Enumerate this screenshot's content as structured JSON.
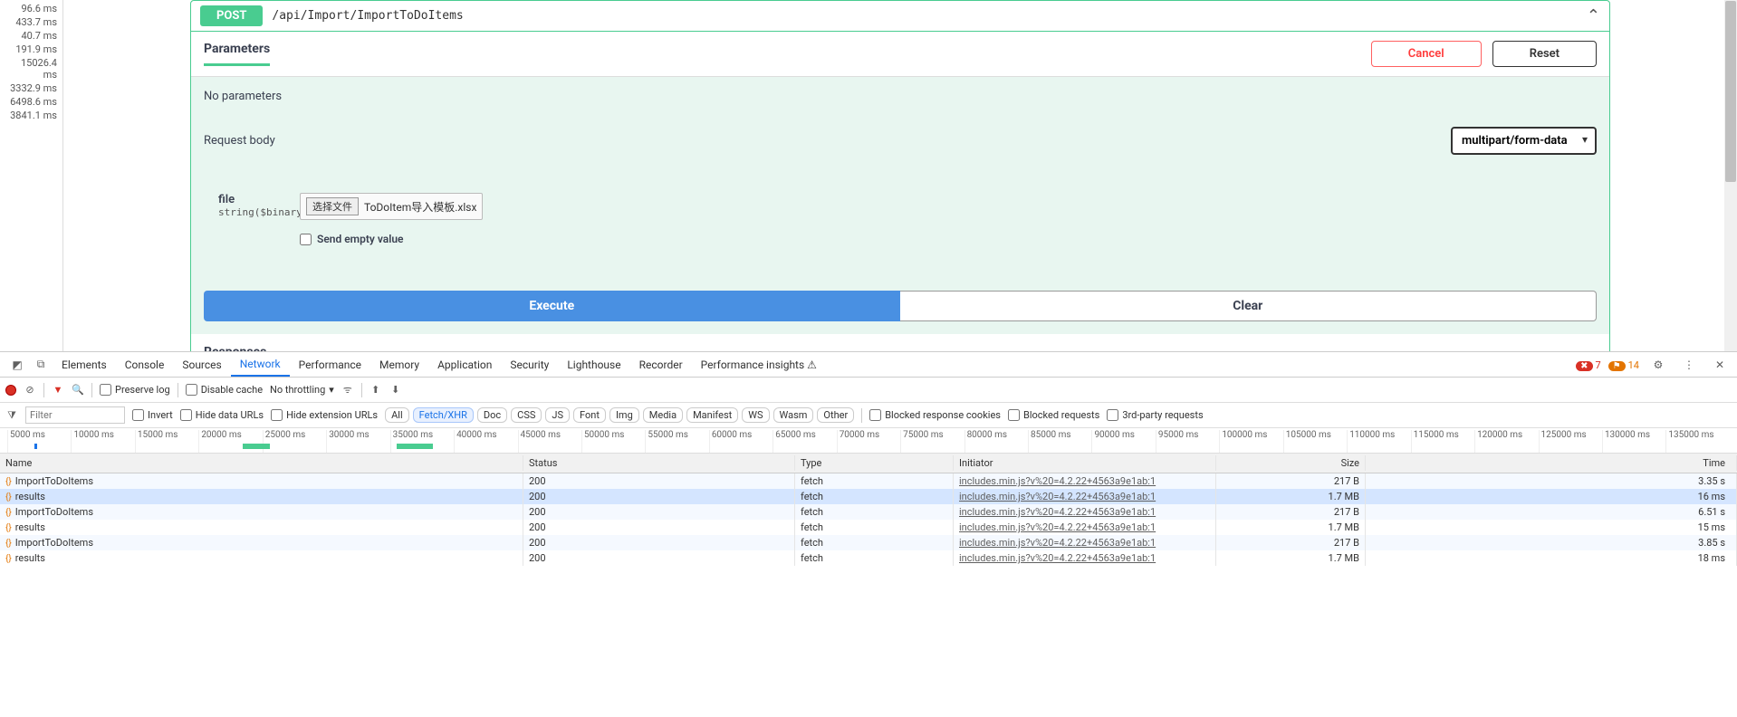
{
  "timings": [
    "96.6 ms",
    "433.7 ms",
    "40.7 ms",
    "191.9 ms",
    "15026.4 ms",
    "3332.9 ms",
    "6498.6 ms",
    "3841.1 ms"
  ],
  "swagger": {
    "method": "POST",
    "path": "/api/Import/ImportToDoItems",
    "tabs": {
      "parameters": "Parameters"
    },
    "buttons": {
      "cancel": "Cancel",
      "reset": "Reset",
      "execute": "Execute",
      "clear": "Clear"
    },
    "no_params": "No parameters",
    "request_body_label": "Request body",
    "content_type": "multipart/form-data",
    "param": {
      "name": "file",
      "type": "string($binary)",
      "choose_file": "选择文件",
      "filename": "ToDoItem导入模板.xlsx",
      "send_empty": "Send empty value"
    },
    "responses_label": "Responses"
  },
  "devtools": {
    "tabs": [
      "Elements",
      "Console",
      "Sources",
      "Network",
      "Performance",
      "Memory",
      "Application",
      "Security",
      "Lighthouse",
      "Recorder",
      "Performance insights"
    ],
    "active_tab": "Network",
    "errors": "7",
    "warnings": "14",
    "toolbar": {
      "preserve_log": "Preserve log",
      "disable_cache": "Disable cache",
      "no_throttling": "No throttling"
    },
    "filter": {
      "placeholder": "Filter",
      "invert": "Invert",
      "hide_data": "Hide data URLs",
      "hide_ext": "Hide extension URLs",
      "types": [
        "All",
        "Fetch/XHR",
        "Doc",
        "CSS",
        "JS",
        "Font",
        "Img",
        "Media",
        "Manifest",
        "WS",
        "Wasm",
        "Other"
      ],
      "active_type": "Fetch/XHR",
      "blocked_cookies": "Blocked response cookies",
      "blocked_req": "Blocked requests",
      "third_party": "3rd-party requests"
    },
    "timeline_ticks": [
      "5000 ms",
      "10000 ms",
      "15000 ms",
      "20000 ms",
      "25000 ms",
      "30000 ms",
      "35000 ms",
      "40000 ms",
      "45000 ms",
      "50000 ms",
      "55000 ms",
      "60000 ms",
      "65000 ms",
      "70000 ms",
      "75000 ms",
      "80000 ms",
      "85000 ms",
      "90000 ms",
      "95000 ms",
      "100000 ms",
      "105000 ms",
      "110000 ms",
      "115000 ms",
      "120000 ms",
      "125000 ms",
      "130000 ms",
      "135000 ms"
    ],
    "columns": {
      "name": "Name",
      "status": "Status",
      "type": "Type",
      "initiator": "Initiator",
      "size": "Size",
      "time": "Time"
    },
    "rows": [
      {
        "name": "ImportToDoItems",
        "status": "200",
        "type": "fetch",
        "initiator": "includes.min.js?v%20=4.2.22+4563a9e1ab:1",
        "size": "217 B",
        "time": "3.35 s",
        "selected": false
      },
      {
        "name": "results",
        "status": "200",
        "type": "fetch",
        "initiator": "includes.min.js?v%20=4.2.22+4563a9e1ab:1",
        "size": "1.7 MB",
        "time": "16 ms",
        "selected": true
      },
      {
        "name": "ImportToDoItems",
        "status": "200",
        "type": "fetch",
        "initiator": "includes.min.js?v%20=4.2.22+4563a9e1ab:1",
        "size": "217 B",
        "time": "6.51 s",
        "selected": false
      },
      {
        "name": "results",
        "status": "200",
        "type": "fetch",
        "initiator": "includes.min.js?v%20=4.2.22+4563a9e1ab:1",
        "size": "1.7 MB",
        "time": "15 ms",
        "selected": false
      },
      {
        "name": "ImportToDoItems",
        "status": "200",
        "type": "fetch",
        "initiator": "includes.min.js?v%20=4.2.22+4563a9e1ab:1",
        "size": "217 B",
        "time": "3.85 s",
        "selected": false
      },
      {
        "name": "results",
        "status": "200",
        "type": "fetch",
        "initiator": "includes.min.js?v%20=4.2.22+4563a9e1ab:1",
        "size": "1.7 MB",
        "time": "18 ms",
        "selected": false
      }
    ]
  }
}
